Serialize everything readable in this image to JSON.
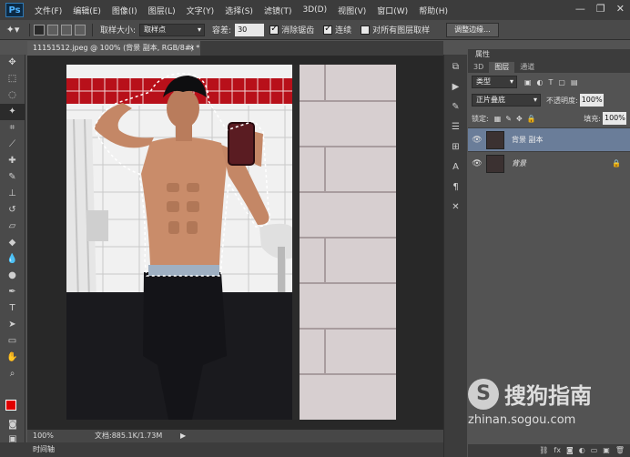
{
  "app": {
    "logo": "Ps"
  },
  "menu": [
    "文件(F)",
    "编辑(E)",
    "图像(I)",
    "图层(L)",
    "文字(Y)",
    "选择(S)",
    "滤镜(T)",
    "3D(D)",
    "视图(V)",
    "窗口(W)",
    "帮助(H)"
  ],
  "window_controls": {
    "minimize": "—",
    "restore": "❐",
    "close": "✕"
  },
  "options": {
    "sample_size_label": "取样大小:",
    "sample_size_value": "取样点",
    "tolerance_label": "容差:",
    "tolerance_value": "30",
    "antialias_label": "消除锯齿",
    "contiguous_label": "连续",
    "sample_all_label": "对所有图层取样",
    "refine_edge_label": "调整边缘..."
  },
  "document": {
    "tab_title": "11151512.jpeg @ 100% (背景 副本, RGB/8#) *",
    "zoom": "100%",
    "doc_size": "文档:885.1K/1.73M"
  },
  "timeline_label": "时间轴",
  "layers_panel": {
    "header": "属性",
    "tabs": [
      "3D",
      "图层",
      "通道"
    ],
    "filter_kind": "类型",
    "blend_mode": "正片叠底",
    "opacity_label": "不透明度:",
    "opacity_value": "100%",
    "lock_label": "锁定:",
    "fill_label": "填充:",
    "fill_value": "100%",
    "layers": [
      {
        "name": "背景 副本",
        "selected": true
      },
      {
        "name": "背景",
        "selected": false
      }
    ]
  },
  "watermark": {
    "brand_cn": "搜狗指南",
    "url": "zhinan.sogou.com"
  },
  "colors": {
    "foreground": "#e00000",
    "background": "#000000",
    "selected_layer": "#6a7d99"
  }
}
